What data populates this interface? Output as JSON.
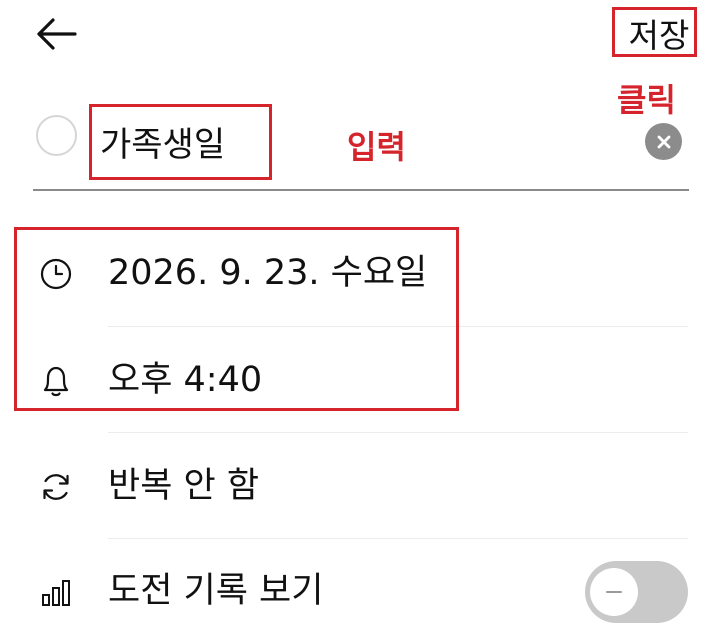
{
  "header": {
    "back_icon": "arrow-left-icon",
    "save_label": "저장"
  },
  "task": {
    "title_value": "가족생일",
    "clear_icon": "close-circle-icon"
  },
  "rows": {
    "date": {
      "icon": "clock-icon",
      "label": "2026. 9. 23. 수요일"
    },
    "reminder": {
      "icon": "bell-icon",
      "label": "오후 4:40"
    },
    "repeat": {
      "icon": "repeat-icon",
      "label": "반복 안 함"
    },
    "challenge": {
      "icon": "bar-chart-icon",
      "label": "도전 기록 보기",
      "toggle_on": false
    }
  },
  "annotations": {
    "click_label": "클릭",
    "input_label": "입력",
    "color": "#d5242c"
  },
  "colors": {
    "text": "#111111",
    "divider": "#ececec",
    "toggle_off": "#c9c9c9"
  }
}
